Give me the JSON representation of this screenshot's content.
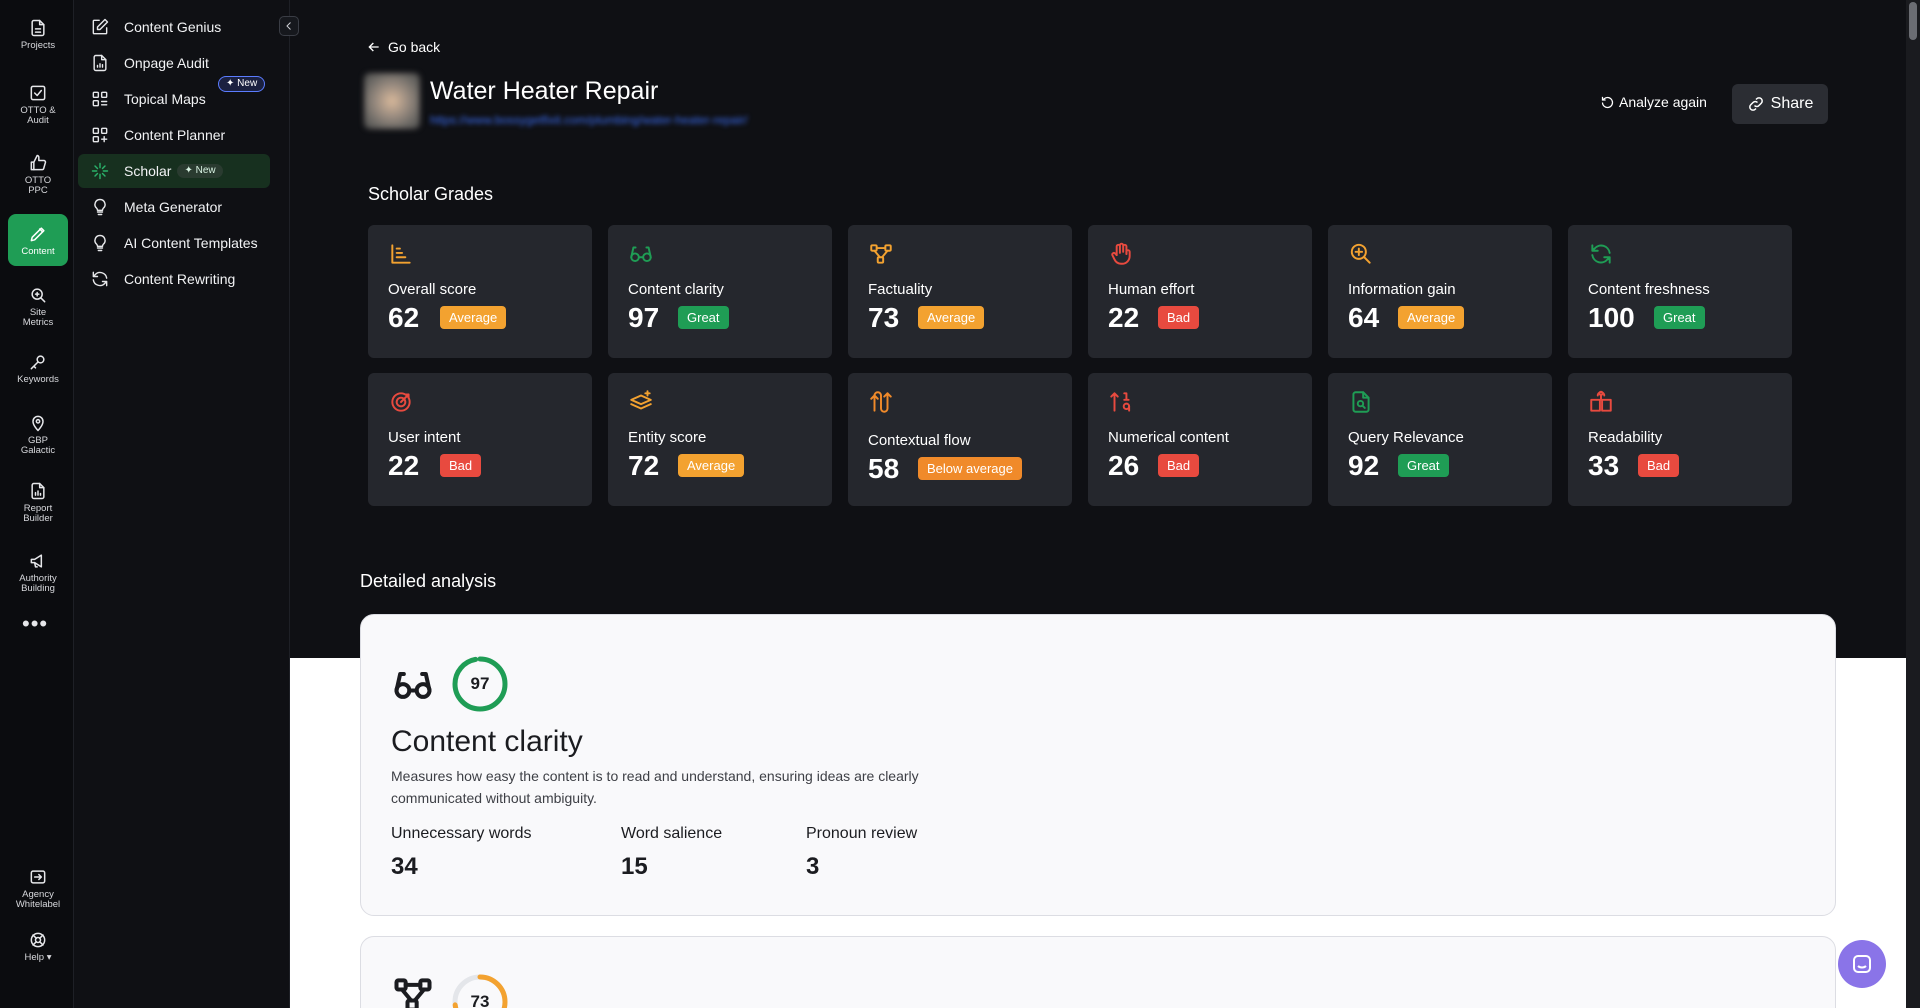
{
  "rail": {
    "items": [
      {
        "label": "Projects",
        "icon": "file-icon"
      },
      {
        "label": "OTTO &\nAudit",
        "icon": "check-doc-icon"
      },
      {
        "label": "OTTO\nPPC",
        "icon": "thumbs-up-icon"
      },
      {
        "label": "Content",
        "icon": "pen-icon"
      },
      {
        "label": "Site\nMetrics",
        "icon": "magnifier-icon"
      },
      {
        "label": "Keywords",
        "icon": "key-icon"
      },
      {
        "label": "GBP\nGalactic",
        "icon": "map-pin-icon"
      },
      {
        "label": "Report\nBuilder",
        "icon": "report-icon"
      },
      {
        "label": "Authority\nBuilding",
        "icon": "megaphone-icon"
      },
      {
        "label": "Agency\nWhitelabel",
        "icon": "agency-icon"
      },
      {
        "label": "Help ▾",
        "icon": "lifebuoy-icon"
      }
    ],
    "more": "•••"
  },
  "submenu": {
    "items": [
      {
        "label": "Content Genius",
        "icon": "edit-icon"
      },
      {
        "label": "Onpage Audit",
        "icon": "audit-icon"
      },
      {
        "label": "Topical Maps",
        "icon": "topical-map-icon",
        "badge": "✦ New"
      },
      {
        "label": "Content Planner",
        "icon": "planner-icon"
      },
      {
        "label": "Scholar",
        "icon": "scholar-icon",
        "badge": "✦ New"
      },
      {
        "label": "Meta Generator",
        "icon": "bulb-icon"
      },
      {
        "label": "AI Content Templates",
        "icon": "bulb-icon"
      },
      {
        "label": "Content Rewriting",
        "icon": "refresh-icon"
      }
    ]
  },
  "header": {
    "go_back": "Go back",
    "title": "Water Heater Repair",
    "url": "https://www.bossygetfixit.com/plumbing/water-heater-repair/",
    "analyze_again": "Analyze again",
    "share": "Share"
  },
  "scholar_grades": {
    "title": "Scholar Grades",
    "cards": [
      {
        "name": "Overall score",
        "score": "62",
        "badge": "Average",
        "status": "average",
        "icon": "bar-chart-icon",
        "color": "#f3a230"
      },
      {
        "name": "Content clarity",
        "score": "97",
        "badge": "Great",
        "status": "great",
        "icon": "glasses-icon",
        "color": "#1f9d55"
      },
      {
        "name": "Factuality",
        "score": "73",
        "badge": "Average",
        "status": "average",
        "icon": "nodes-icon",
        "color": "#f3a230"
      },
      {
        "name": "Human effort",
        "score": "22",
        "badge": "Bad",
        "status": "bad",
        "icon": "hand-icon",
        "color": "#e84a3f"
      },
      {
        "name": "Information gain",
        "score": "64",
        "badge": "Average",
        "status": "average",
        "icon": "zoom-plus-icon",
        "color": "#f3a230"
      },
      {
        "name": "Content freshness",
        "score": "100",
        "badge": "Great",
        "status": "great",
        "icon": "refresh-icon",
        "color": "#1f9d55"
      },
      {
        "name": "User intent",
        "score": "22",
        "badge": "Bad",
        "status": "bad",
        "icon": "target-icon",
        "color": "#e84a3f"
      },
      {
        "name": "Entity score",
        "score": "72",
        "badge": "Average",
        "status": "average",
        "icon": "layers-icon",
        "color": "#f3a230"
      },
      {
        "name": "Contextual flow",
        "score": "58",
        "badge": "Below average",
        "status": "below",
        "icon": "flow-arrows-icon",
        "color": "#f08a2a"
      },
      {
        "name": "Numerical content",
        "score": "26",
        "badge": "Bad",
        "status": "bad",
        "icon": "sort-numbers-icon",
        "color": "#e84a3f"
      },
      {
        "name": "Query Relevance",
        "score": "92",
        "badge": "Great",
        "status": "great",
        "icon": "doc-search-icon",
        "color": "#1f9d55"
      },
      {
        "name": "Readability",
        "score": "33",
        "badge": "Bad",
        "status": "bad",
        "icon": "book-open-icon",
        "color": "#e84a3f"
      }
    ]
  },
  "detailed_analysis": {
    "title": "Detailed analysis",
    "card": {
      "score": "97",
      "score_fraction": 0.97,
      "ring_color": "#1f9d55",
      "title": "Content clarity",
      "description": "Measures how easy the content is to read and understand, ensuring ideas are clearly communicated without ambiguity.",
      "metrics": [
        {
          "label": "Unnecessary words",
          "value": "34"
        },
        {
          "label": "Word salience",
          "value": "15"
        },
        {
          "label": "Pronoun review",
          "value": "3"
        }
      ]
    },
    "next_card": {
      "score": "73",
      "score_fraction": 0.73,
      "ring_color": "#f3a230"
    }
  }
}
